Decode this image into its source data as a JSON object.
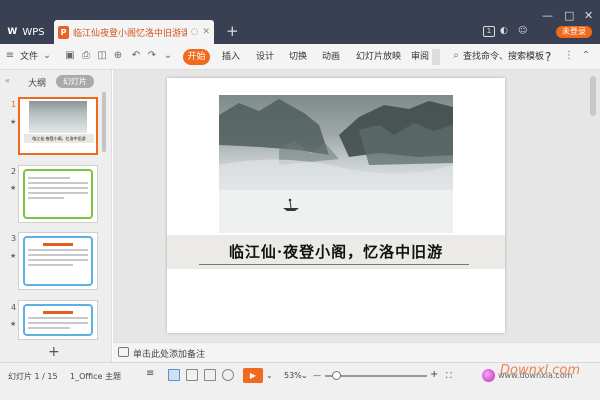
{
  "titlebar": {
    "app_tab": "WPS",
    "doc_tab_title": "临江仙夜登小阁忆洛中旧游课件",
    "new_tab": "+",
    "badge": "1",
    "login": "未登录",
    "window_controls": [
      "—",
      "□",
      "✕"
    ]
  },
  "toolbar": {
    "file_menu": "文件",
    "start": "开始",
    "menus": [
      "插入",
      "设计",
      "切换",
      "动画",
      "幻灯片放映",
      "审阅"
    ],
    "search": "查找命令、搜索模板",
    "help": "?"
  },
  "sidebar": {
    "tab_outline": "大纲",
    "tab_slides": "幻灯片",
    "thumbnails": [
      {
        "num": "1",
        "title": "临江仙·夜登小阁，忆洛中旧游"
      },
      {
        "num": "2"
      },
      {
        "num": "3"
      },
      {
        "num": "4"
      }
    ],
    "add_slide": "+"
  },
  "slide": {
    "title": "临江仙·夜登小阁，忆洛中旧游"
  },
  "notes": {
    "placeholder": "单击此处添加备注"
  },
  "statusbar": {
    "slide_indicator": "幻灯片 1 / 15",
    "theme": "1_Office 主题",
    "zoom": "53%",
    "zoom_minus": "—",
    "zoom_plus": "+",
    "zoom_level": 0.53,
    "watermark_text": "www.downxia.com",
    "watermark_url": "Downxl.com"
  },
  "colors": {
    "accent": "#f06a1d",
    "titlebar_bg": "#3a4054"
  }
}
